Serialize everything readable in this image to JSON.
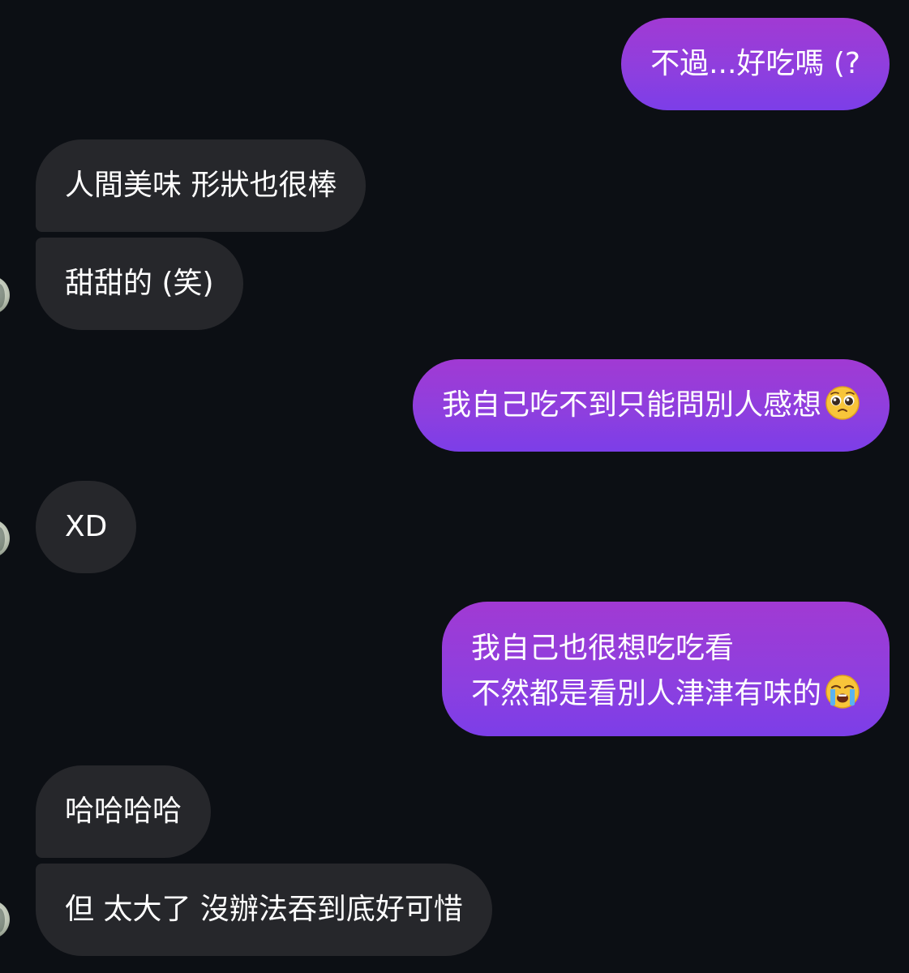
{
  "conversation": {
    "messages": [
      {
        "side": "sent",
        "text": "不過...好吃嗎 (?"
      },
      {
        "side": "received",
        "text": "人間美味 形狀也很棒"
      },
      {
        "side": "received",
        "text": "甜甜的 (笑)"
      },
      {
        "side": "sent",
        "text": "我自己吃不到只能問別人感想",
        "emoji": "pleading-face"
      },
      {
        "side": "received",
        "text": "XD"
      },
      {
        "side": "sent",
        "lines": [
          "我自己也很想吃吃看",
          "不然都是看別人津津有味的"
        ],
        "emoji": "loudly-crying-face"
      },
      {
        "side": "received",
        "text": "哈哈哈哈"
      },
      {
        "side": "received",
        "text": "但 太大了 沒辦法吞到底好可惜"
      }
    ]
  },
  "colors": {
    "background": "#0c0f14",
    "received_bubble": "#26272b",
    "sent_bubble_top": "#a13ad3",
    "sent_bubble_bottom": "#7c3ee8",
    "text": "#ffffff"
  }
}
